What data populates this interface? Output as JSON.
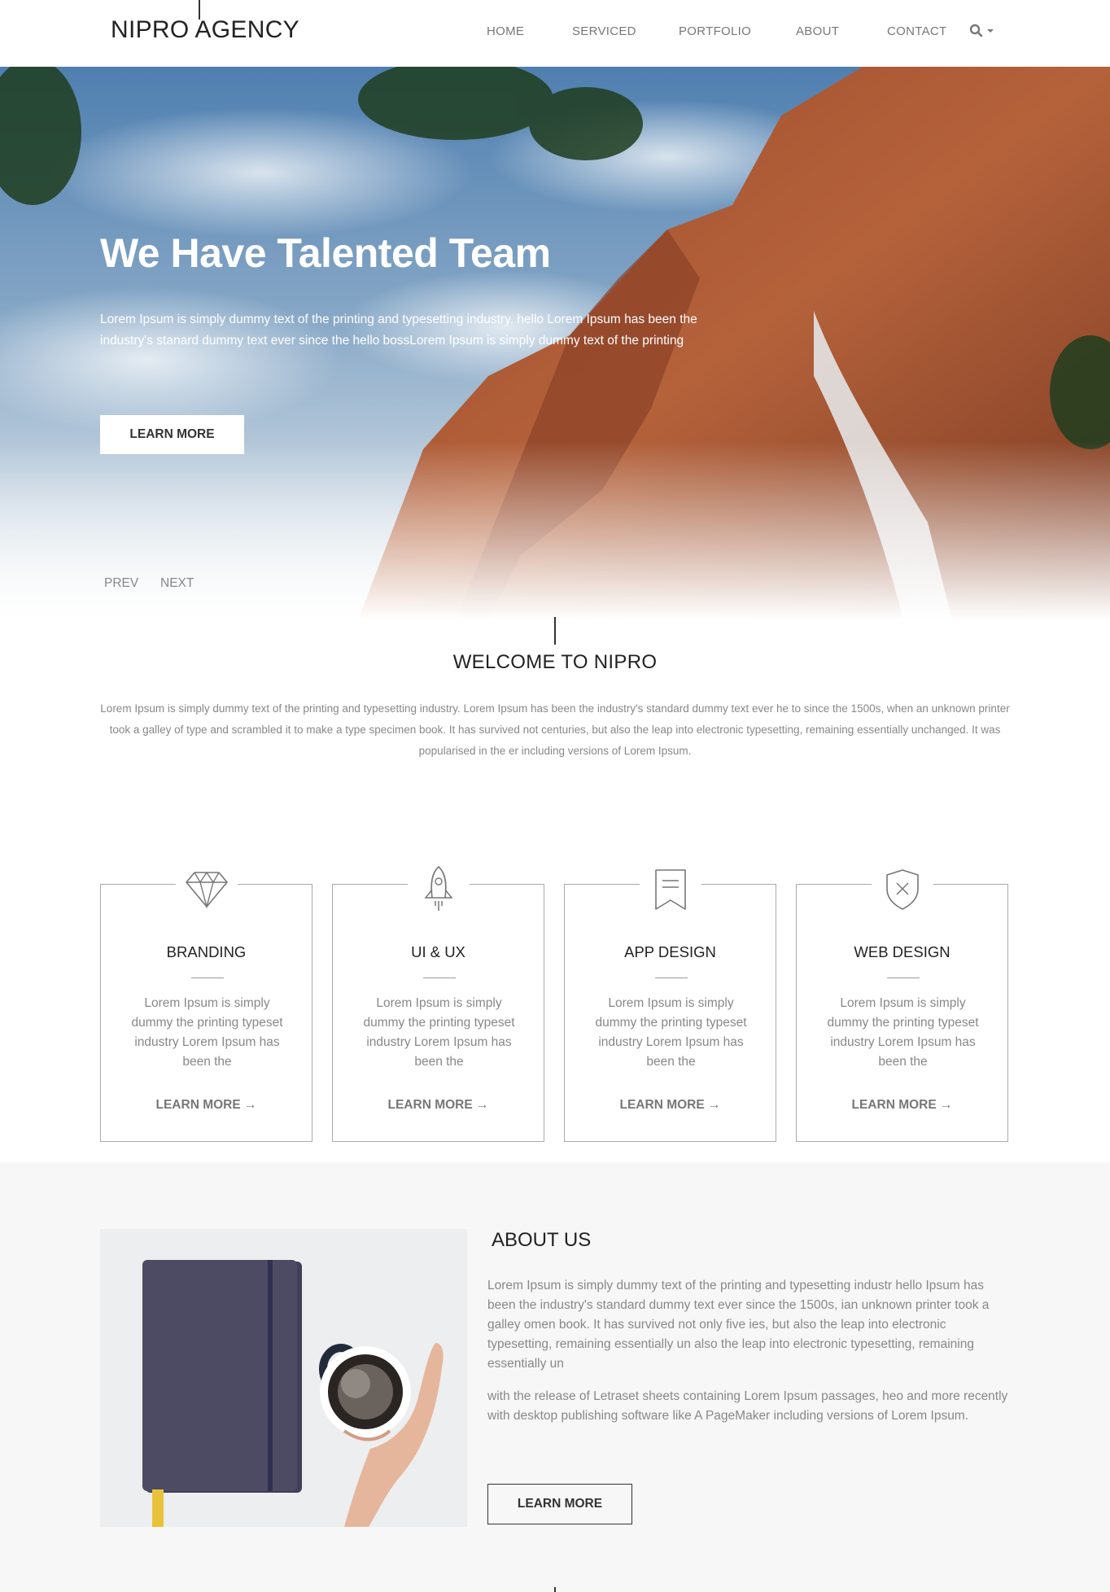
{
  "header": {
    "logo": "NIPRO AGENCY",
    "nav": [
      {
        "label": "HOME"
      },
      {
        "label": "SERVICED"
      },
      {
        "label": "PORTFOLIO"
      },
      {
        "label": "ABOUT"
      },
      {
        "label": "CONTACT"
      }
    ],
    "search_icon": "search-icon"
  },
  "hero": {
    "title": "We Have Talented Team",
    "text": "Lorem Ipsum is simply dummy text of the printing and typesetting industry. hello Lorem Ipsum has been the industry's stanard dummy text ever since the hello bossLorem Ipsum is simply dummy text of the printing",
    "button": "LEARN MORE",
    "prev": "PREV",
    "next": "NEXT"
  },
  "welcome": {
    "title": "WELCOME TO NIPRO",
    "text": "Lorem Ipsum is simply dummy text of the printing and typesetting industry. Lorem Ipsum has been the industry's standard dummy text ever he to since the 1500s, when an unknown printer took a galley of type and scrambled it to make a type specimen book. It has survived not centuries, but also the leap into electronic typesetting, remaining essentially unchanged. It was popularised in the er including versions of Lorem Ipsum."
  },
  "services": [
    {
      "icon": "diamond-icon",
      "title": "BRANDING",
      "text": "Lorem Ipsum is simply dummy the printing typeset industry Lorem Ipsum has been the",
      "link": "LEARN MORE →"
    },
    {
      "icon": "rocket-icon",
      "title": "UI & UX",
      "text": "Lorem Ipsum is simply dummy the printing typeset industry Lorem Ipsum has been the",
      "link": "LEARN MORE →"
    },
    {
      "icon": "bookmark-icon",
      "title": "APP DESIGN",
      "text": "Lorem Ipsum is simply dummy the printing typeset industry Lorem Ipsum has been the",
      "link": "LEARN MORE →"
    },
    {
      "icon": "shield-icon",
      "title": "WEB DESIGN",
      "text": "Lorem Ipsum is simply dummy the printing typeset industry Lorem Ipsum has been the",
      "link": "LEARN MORE →"
    }
  ],
  "about": {
    "title": "ABOUT US",
    "p1": "Lorem Ipsum is simply dummy text of the printing and typesetting industr hello Ipsum has been the industry's standard dummy text ever since the 1500s, ian unknown printer took a galley omen book. It has survived not only five ies, but also the leap into electronic typesetting, remaining essentially un also the leap into electronic typesetting, remaining essentially un",
    "p2": "with the release of Letraset sheets containing Lorem Ipsum passages, heo and more recently with desktop publishing software like A PageMaker including versions of Lorem Ipsum.",
    "button": "LEARN MORE",
    "image_icon": "notebook-coffee-image"
  },
  "colors": {
    "text_dark": "#222222",
    "text_muted": "#888888",
    "about_bg": "#f7f7f7"
  }
}
